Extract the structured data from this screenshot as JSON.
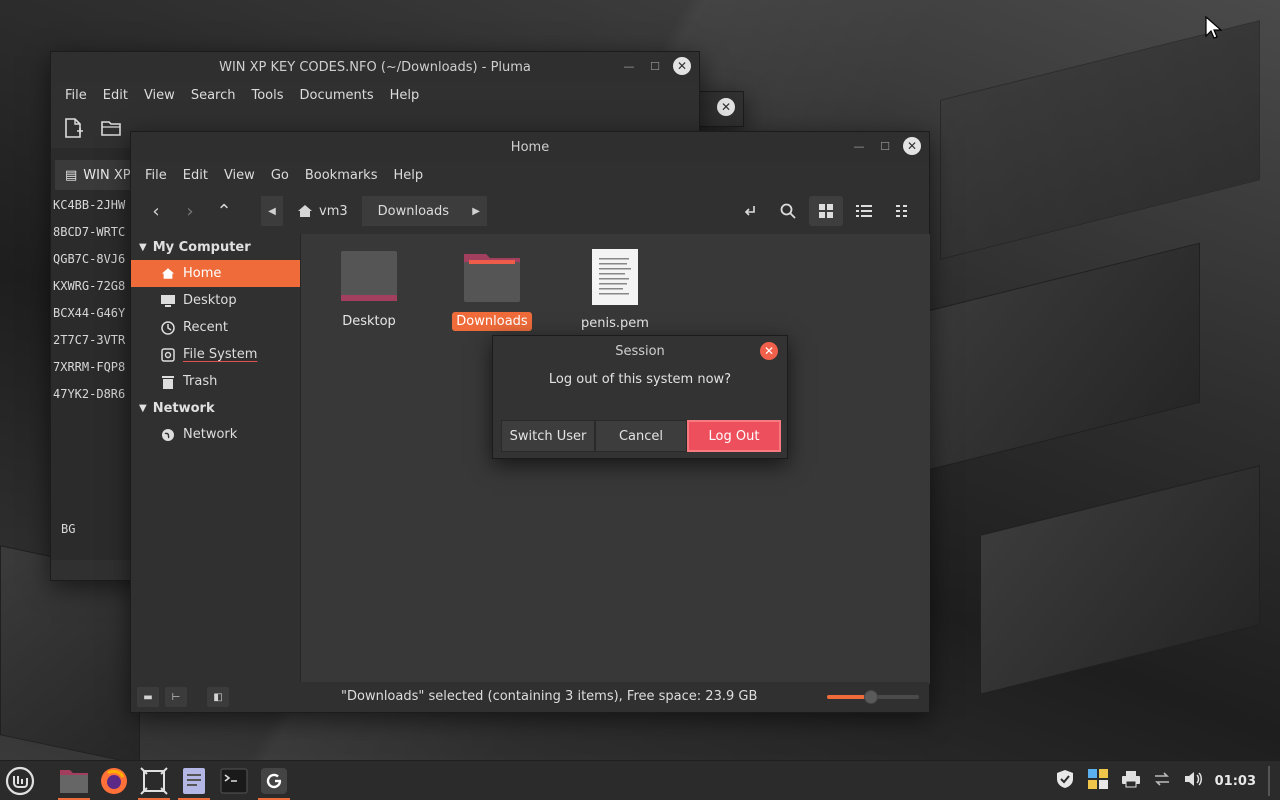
{
  "pluma": {
    "title": "WIN XP KEY CODES.NFO (~/Downloads) - Pluma",
    "menu": [
      "File",
      "Edit",
      "View",
      "Search",
      "Tools",
      "Documents",
      "Help"
    ],
    "tab_label": "WIN XP",
    "lines": [
      "KC4BB-2JHW",
      "8BCD7-WRTC",
      "QGB7C-8VJ6",
      "KXWRG-72G8",
      "BCX44-G46Y",
      "2T7C7-3VTR",
      "7XRRM-FQP8",
      "47YK2-D8R6"
    ],
    "trailing_text": "BG"
  },
  "nemo": {
    "title": "Home",
    "menu": [
      "File",
      "Edit",
      "View",
      "Go",
      "Bookmarks",
      "Help"
    ],
    "path": {
      "home_label": "vm3",
      "current": "Downloads"
    },
    "sidebar": {
      "sections": [
        {
          "header": "My Computer",
          "items": [
            {
              "label": "Home",
              "icon": "home-icon",
              "selected": true
            },
            {
              "label": "Desktop",
              "icon": "desktop-icon"
            },
            {
              "label": "Recent",
              "icon": "recent-icon"
            },
            {
              "label": "File System",
              "icon": "drive-icon"
            },
            {
              "label": "Trash",
              "icon": "trash-icon"
            }
          ]
        },
        {
          "header": "Network",
          "items": [
            {
              "label": "Network",
              "icon": "network-icon"
            }
          ]
        }
      ]
    },
    "files": [
      {
        "label": "Desktop",
        "icon": "desktop-folder-icon",
        "selected": false
      },
      {
        "label": "Downloads",
        "icon": "downloads-folder-icon",
        "selected": true
      },
      {
        "label": "penis.pem",
        "icon": "text-file-icon",
        "selected": false
      }
    ],
    "status": "\"Downloads\" selected (containing 3 items), Free space: 23.9 GB",
    "zoom_fraction": 0.48
  },
  "session": {
    "title": "Session",
    "message": "Log out of this system now?",
    "buttons": {
      "switch_user": "Switch User",
      "cancel": "Cancel",
      "log_out": "Log Out"
    }
  },
  "taskbar": {
    "clock": "01:03"
  },
  "colors": {
    "accent": "#ef6c3a",
    "danger": "#ee4f5c",
    "window_bg": "#303030"
  }
}
